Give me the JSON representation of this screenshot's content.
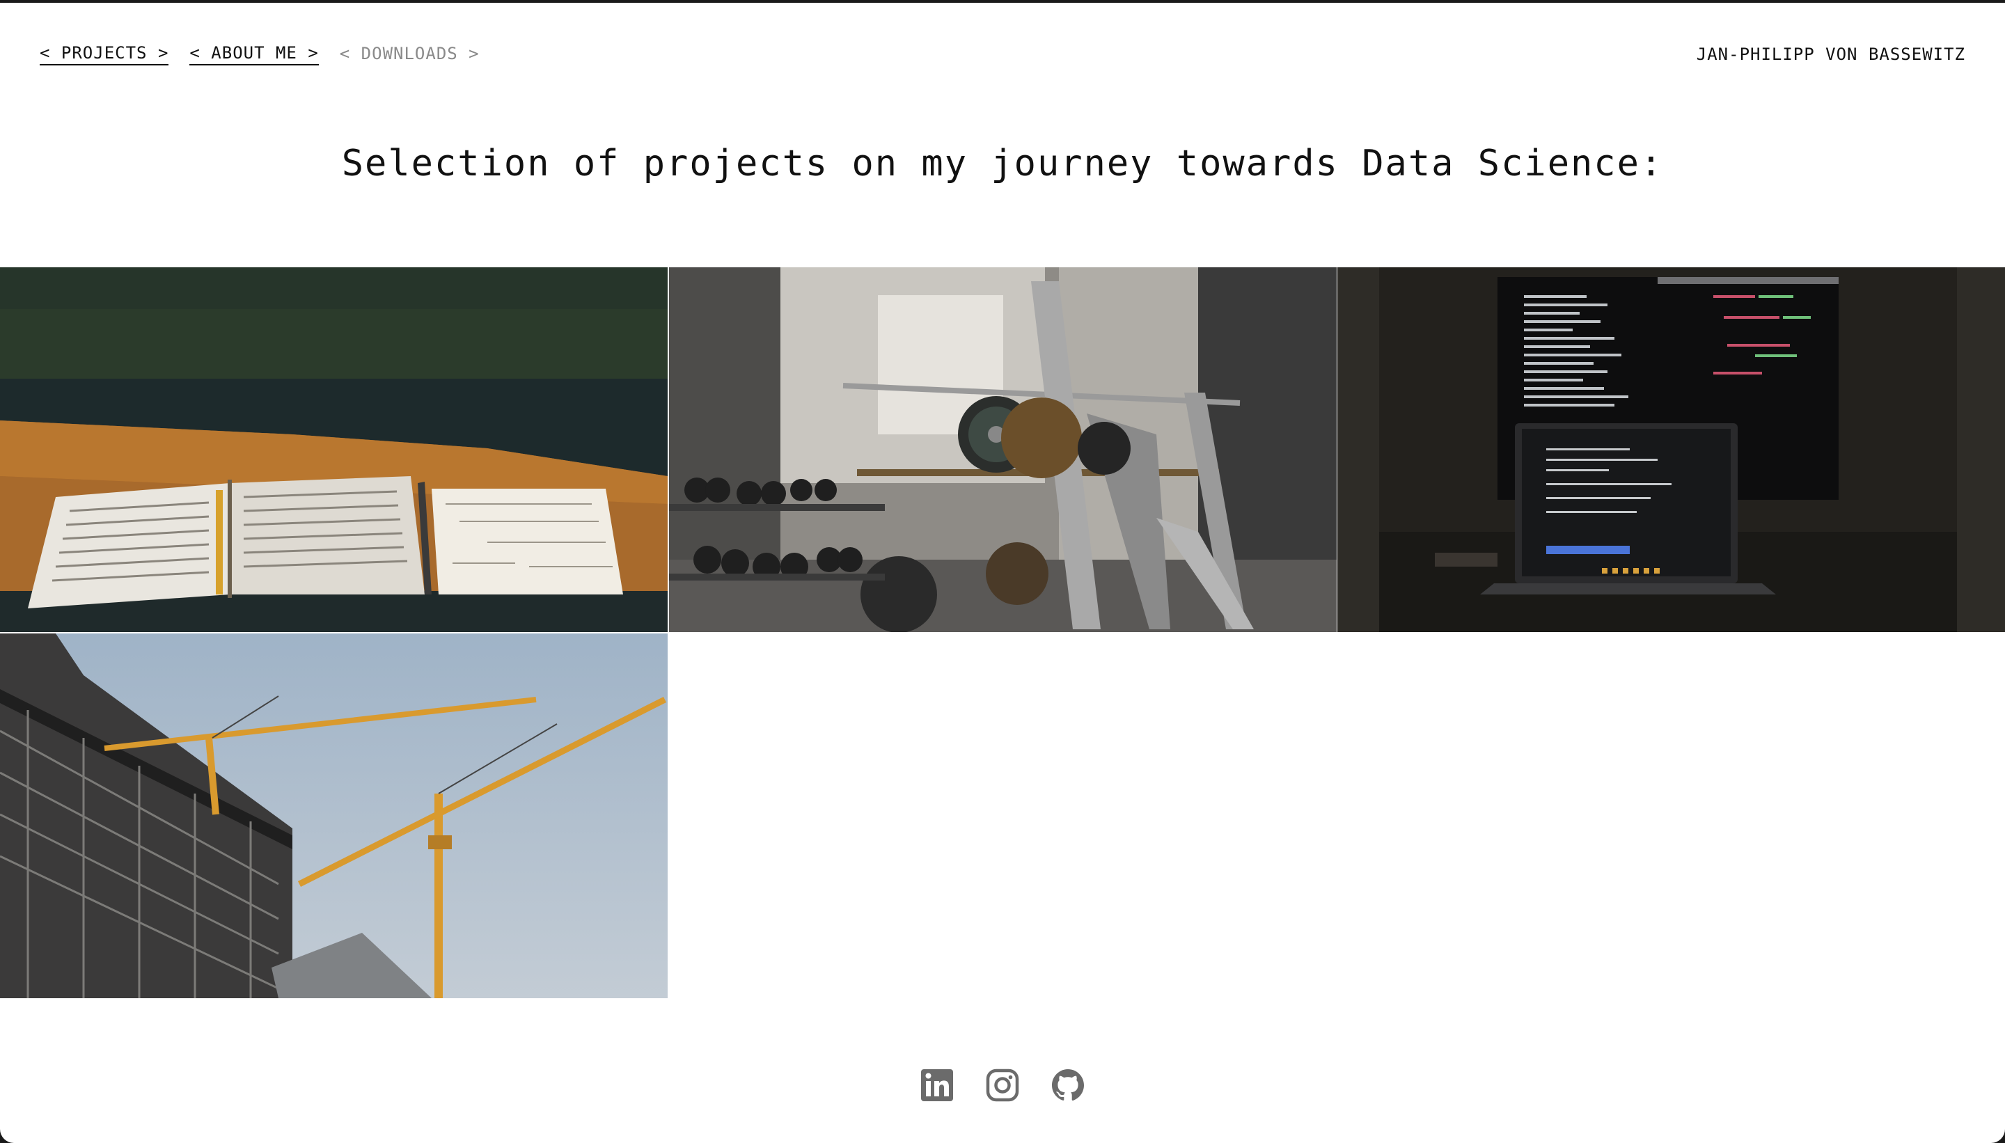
{
  "nav": {
    "projects": "< PROJECTS >",
    "about": "< ABOUT ME >",
    "downloads": "< DOWNLOADS >"
  },
  "site_name": "JAN-PHILIPP VON BASSEWITZ",
  "page_title": "Selection of projects on my journey towards Data Science:",
  "projects": [
    {
      "image": "open-books-notebook-on-table-photo"
    },
    {
      "image": "gym-barbell-rack-photo"
    },
    {
      "image": "laptop-and-monitor-code-photo"
    },
    {
      "image": "construction-cranes-building-photo"
    }
  ],
  "social": [
    {
      "icon": "linkedin-icon"
    },
    {
      "icon": "instagram-icon"
    },
    {
      "icon": "github-icon"
    }
  ],
  "colors": {
    "text": "#111111",
    "nav_inactive": "#8a8a8a",
    "icon_gray": "#6b6b6b",
    "background": "#ffffff"
  }
}
